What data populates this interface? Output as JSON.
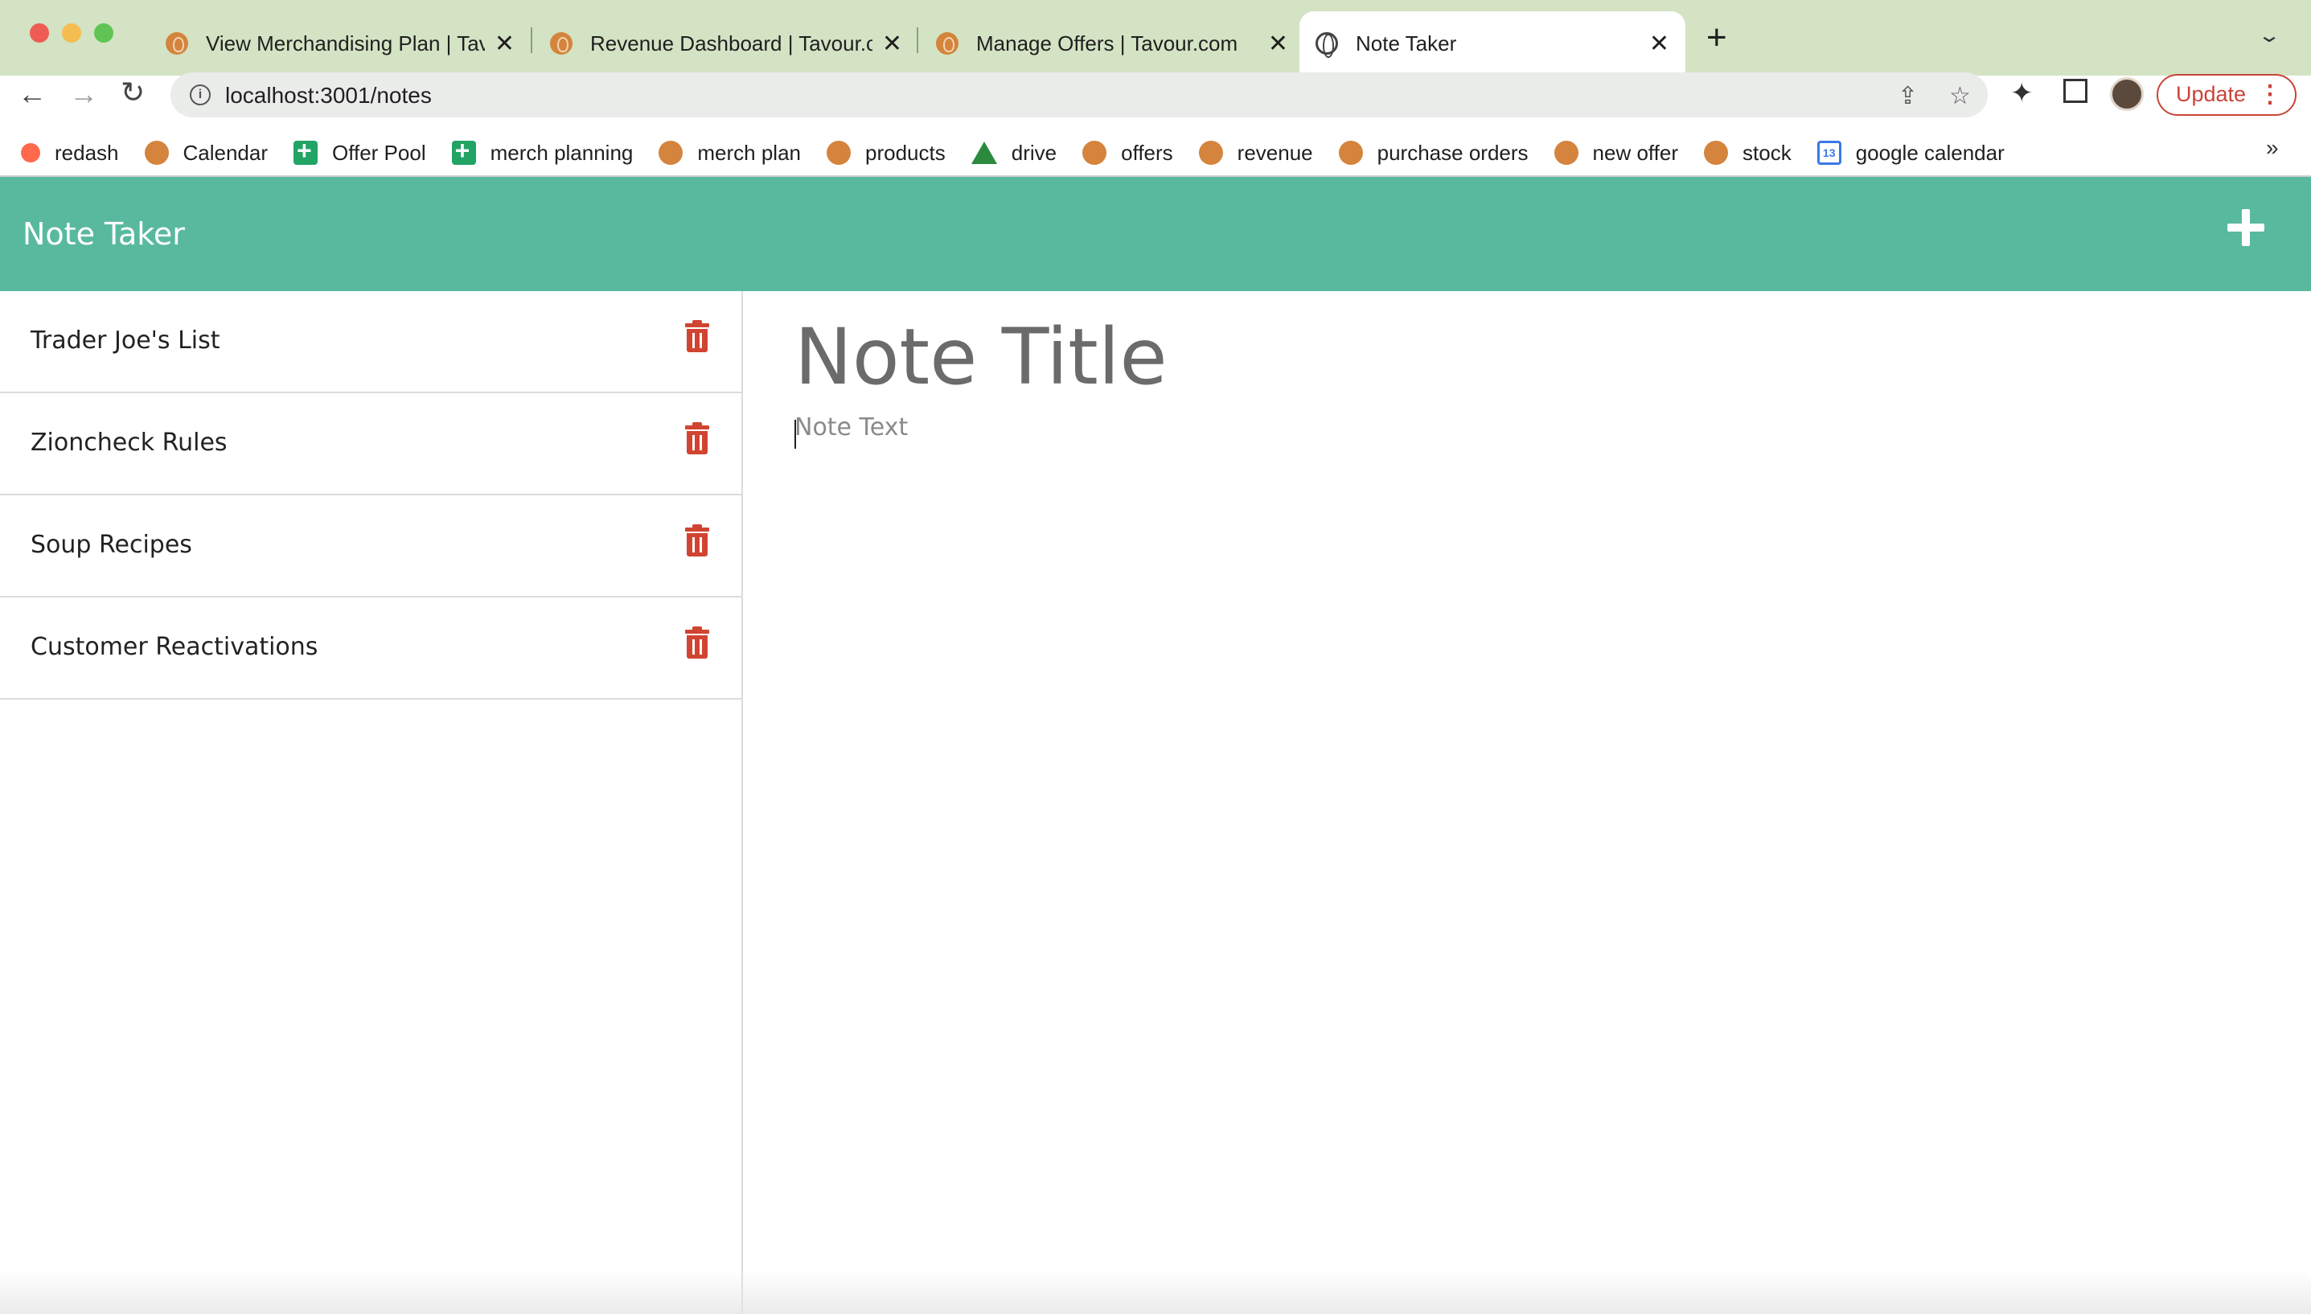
{
  "browser": {
    "tabs": [
      {
        "title": "View Merchandising Plan | Tavour.com",
        "icon": "tavour-icon"
      },
      {
        "title": "Revenue Dashboard | Tavour.com",
        "icon": "tavour-icon"
      },
      {
        "title": "Manage Offers | Tavour.com",
        "icon": "tavour-icon"
      },
      {
        "title": "Note Taker",
        "icon": "globe-icon",
        "active": true
      }
    ],
    "url": "localhost:3001/notes",
    "update_label": "Update",
    "bookmarks": [
      {
        "label": "redash",
        "icon": "redash-icon"
      },
      {
        "label": "Calendar",
        "icon": "tavour-icon"
      },
      {
        "label": "Offer Pool",
        "icon": "sheets-icon"
      },
      {
        "label": "merch planning",
        "icon": "sheets-icon"
      },
      {
        "label": "merch plan",
        "icon": "tavour-icon"
      },
      {
        "label": "products",
        "icon": "tavour-icon"
      },
      {
        "label": "drive",
        "icon": "drive-icon"
      },
      {
        "label": "offers",
        "icon": "tavour-icon"
      },
      {
        "label": "revenue",
        "icon": "tavour-icon"
      },
      {
        "label": "purchase orders",
        "icon": "tavour-icon"
      },
      {
        "label": "new offer",
        "icon": "tavour-icon"
      },
      {
        "label": "stock",
        "icon": "tavour-icon"
      },
      {
        "label": "google calendar",
        "icon": "google-calendar-icon",
        "badge": "13"
      }
    ],
    "more_bookmarks": "»"
  },
  "app": {
    "title": "Note Taker",
    "accent_color": "#59b99e",
    "delete_color": "#d04431",
    "notes": [
      {
        "title": "Trader Joe's List"
      },
      {
        "title": "Zioncheck Rules"
      },
      {
        "title": "Soup Recipes"
      },
      {
        "title": "Customer Reactivations"
      }
    ],
    "editor": {
      "title_placeholder": "Note Title",
      "text_placeholder": "Note Text"
    }
  }
}
